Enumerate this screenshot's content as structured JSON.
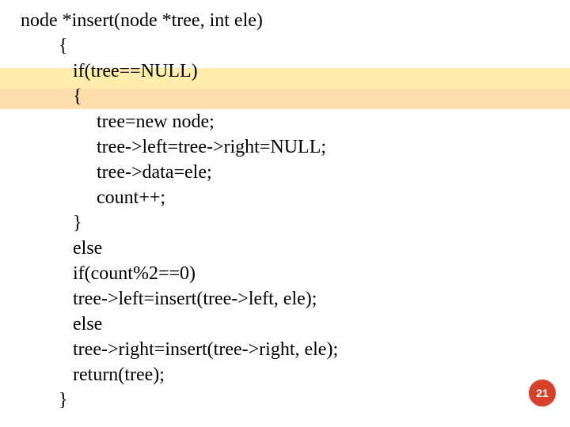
{
  "code": {
    "l0": "node *insert(node *tree, int ele)",
    "l1": "        {",
    "l2": "           if(tree==NULL)",
    "l3": "           {",
    "l4": "                tree=new node;",
    "l5": "                tree->left=tree->right=NULL;",
    "l6": "                tree->data=ele;",
    "l7": "                count++;",
    "l8": "           }",
    "l9": "           else",
    "l10": "           if(count%2==0)",
    "l11": "           tree->left=insert(tree->left, ele);",
    "l12": "           else",
    "l13": "           tree->right=insert(tree->right, ele);",
    "l14": "           return(tree);",
    "l15": "        }"
  },
  "page_number": "21"
}
